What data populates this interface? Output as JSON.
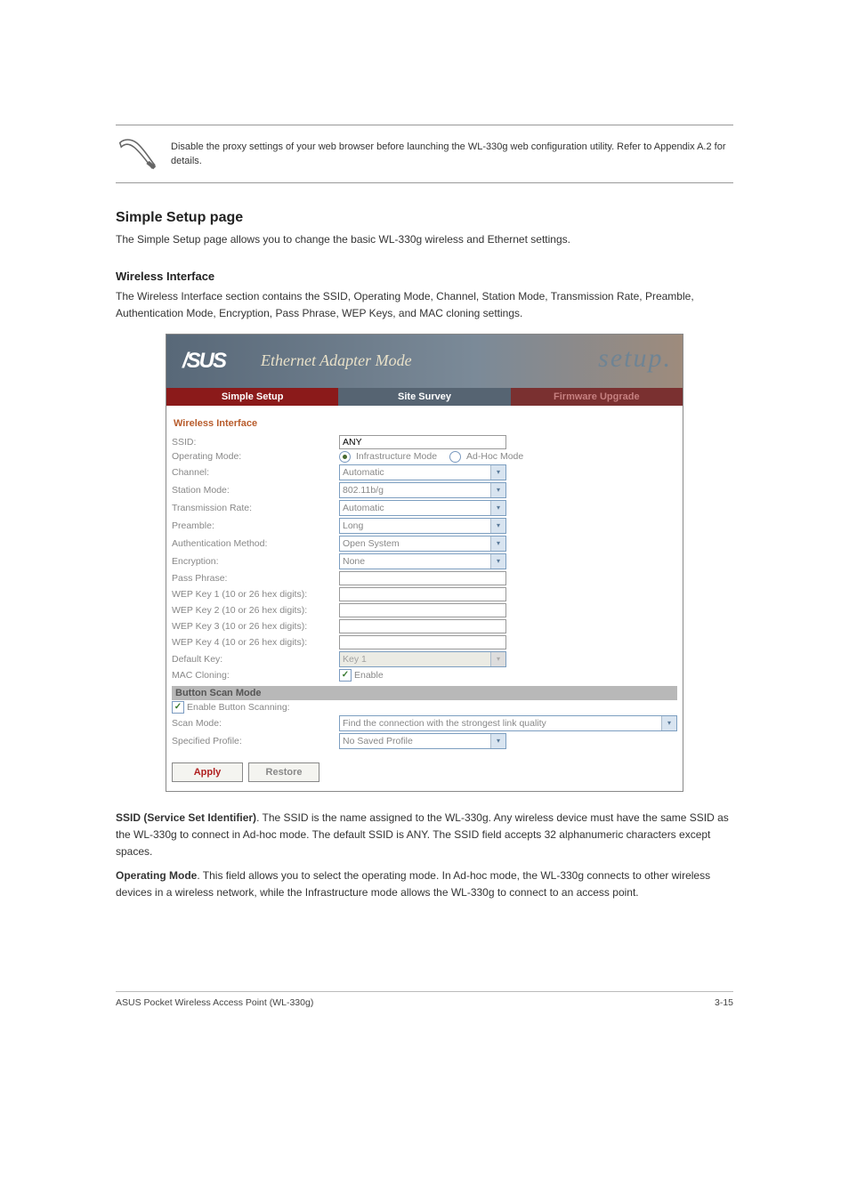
{
  "note": "Disable the proxy settings of your web browser before launching the WL-330g web configuration utility. Refer to Appendix A.2 for details.",
  "main_heading": "Simple Setup page",
  "main_text": "The Simple Setup page allows you to change the basic WL-330g wireless and Ethernet settings.",
  "sub_heading": "Wireless Interface",
  "sub_text": "The Wireless Interface section contains the SSID, Operating Mode, Channel, Station Mode, Transmission Rate, Preamble, Authentication Mode, Encryption, Pass Phrase, WEP Keys, and MAC cloning settings.",
  "screenshot": {
    "logo": "/SUS",
    "mode_title": "Ethernet Adapter Mode",
    "setup_word": "setup.",
    "tabs": {
      "simple_setup": "Simple Setup",
      "site_survey": "Site Survey",
      "firmware_upgrade": "Firmware Upgrade"
    },
    "section_wireless": "Wireless Interface",
    "labels": {
      "ssid": "SSID:",
      "operating_mode": "Operating Mode:",
      "channel": "Channel:",
      "station_mode": "Station Mode:",
      "transmission_rate": "Transmission Rate:",
      "preamble": "Preamble:",
      "auth_method": "Authentication Method:",
      "encryption": "Encryption:",
      "pass_phrase": "Pass Phrase:",
      "wep1": "WEP Key 1 (10 or 26 hex digits):",
      "wep2": "WEP Key 2 (10 or 26 hex digits):",
      "wep3": "WEP Key 3 (10 or 26 hex digits):",
      "wep4": "WEP Key 4 (10 or 26 hex digits):",
      "default_key": "Default Key:",
      "mac_cloning": "MAC Cloning:"
    },
    "values": {
      "ssid": "ANY",
      "infra": "Infrastructure Mode",
      "adhoc": "Ad-Hoc Mode",
      "channel": "Automatic",
      "station_mode": "802.11b/g",
      "transmission_rate": "Automatic",
      "preamble": "Long",
      "auth_method": "Open System",
      "encryption": "None",
      "default_key": "Key 1",
      "enable": "Enable"
    },
    "section_button_scan": "Button Scan Mode",
    "scan_labels": {
      "enable_button_scanning": "Enable Button Scanning:",
      "scan_mode": "Scan Mode:",
      "specified_profile": "Specified Profile:"
    },
    "scan_values": {
      "scan_mode": "Find the connection with the strongest link quality",
      "specified_profile": "No Saved Profile"
    },
    "buttons": {
      "apply": "Apply",
      "restore": "Restore"
    }
  },
  "after_para_1_prefix": "SSID (Service Set Identifier)",
  "after_para_1": ". The SSID is the name assigned to the WL-330g. Any wireless device must have the same SSID as the WL-330g to connect in Ad-hoc mode. The default SSID is ANY. The SSID field accepts 32 alphanumeric characters except spaces.",
  "after_para_2_prefix": "Operating Mode",
  "after_para_2": ". This field allows you to select the operating mode. In Ad-hoc mode, the WL-330g connects to other wireless devices in a wireless network, while the Infrastructure mode allows the WL-330g to connect to an access point.",
  "footer_left": "ASUS Pocket Wireless Access Point (WL-330g)",
  "footer_right": "3-15"
}
